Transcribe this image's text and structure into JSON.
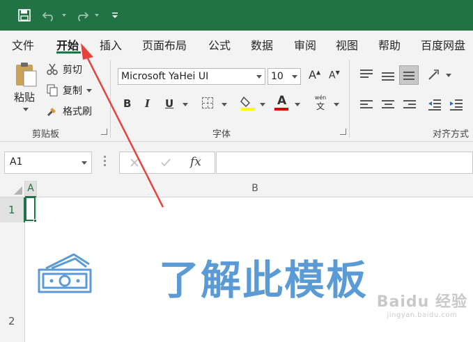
{
  "tabs": [
    "文件",
    "开始",
    "插入",
    "页面布局",
    "公式",
    "数据",
    "审阅",
    "视图",
    "帮助",
    "百度网盘"
  ],
  "active_tab": "开始",
  "clipboard": {
    "paste_label": "粘贴",
    "cut_label": "剪切",
    "copy_label": "复制",
    "format_painter_label": "格式刷",
    "group_label": "剪贴板"
  },
  "font": {
    "font_name": "Microsoft YaHei UI",
    "font_size": "10",
    "bold": "B",
    "italic": "I",
    "underline": "U",
    "font_color_glyph": "A",
    "phonetic_top": "wén",
    "phonetic_bottom": "文",
    "group_label": "字体"
  },
  "alignment": {
    "group_label": "对齐方式"
  },
  "formula_bar": {
    "name_box_value": "A1",
    "fx_label": "fx",
    "formula_value": ""
  },
  "grid": {
    "columns": [
      "A",
      "B"
    ],
    "rows": [
      "1",
      "2"
    ]
  },
  "content": {
    "banner_text": "了解此模板"
  },
  "watermark": {
    "main": "Baidu 经验",
    "sub": "jingyan.baidu.com"
  },
  "colors": {
    "title_bar": "#217346",
    "accent_blue": "#5b9bd5",
    "arrow_red": "#e8423c"
  }
}
